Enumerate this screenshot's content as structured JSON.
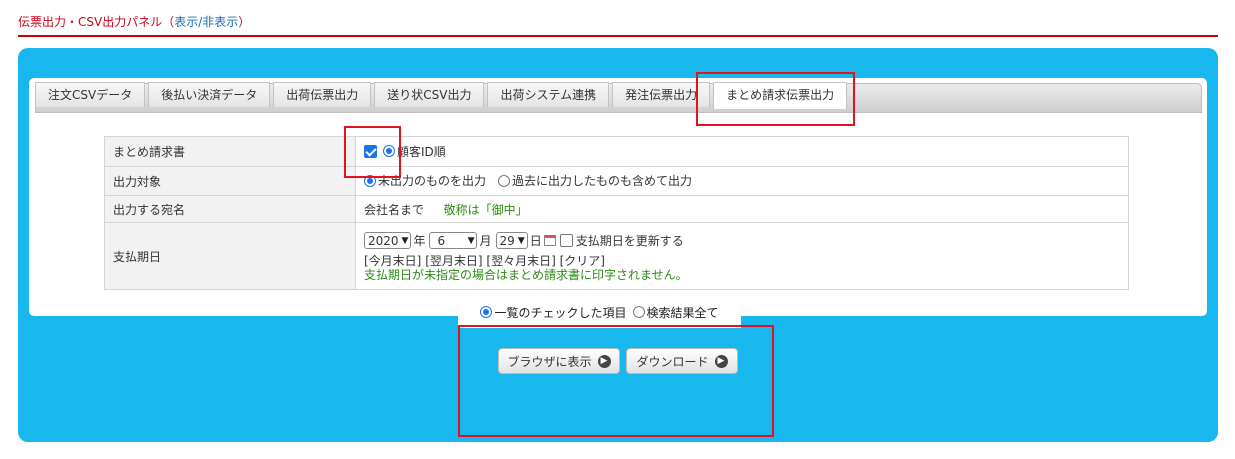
{
  "panel": {
    "title": "伝票出力・CSV出力パネル（",
    "toggle_label": "表示/非表示",
    "title_suffix": "）"
  },
  "tabs": [
    {
      "label": "注文CSVデータ",
      "active": false
    },
    {
      "label": "後払い決済データ",
      "active": false
    },
    {
      "label": "出荷伝票出力",
      "active": false
    },
    {
      "label": "送り状CSV出力",
      "active": false
    },
    {
      "label": "出荷システム連携",
      "active": false
    },
    {
      "label": "発注伝票出力",
      "active": false
    },
    {
      "label": "まとめ請求伝票出力",
      "active": true
    }
  ],
  "settings": {
    "invoice": {
      "label": "まとめ請求書",
      "checked": true,
      "sort_option": "顧客ID順"
    },
    "target": {
      "label": "出力対象",
      "options": [
        "未出力のものを出力",
        "過去に出力したものも含めて出力"
      ],
      "selected": "未出力のものを出力"
    },
    "address": {
      "label": "出力する宛名",
      "value": "会社名まで",
      "note": "敬称は「御中」"
    },
    "due_date": {
      "label": "支払期日",
      "year": "2020",
      "year_unit": "年",
      "month": "6",
      "month_unit": "月",
      "day": "29",
      "day_unit": "日",
      "update_label": "支払期日を更新する",
      "update_checked": false,
      "quick_links": [
        "[今月末日]",
        "[翌月末日]",
        "[翌々月末日]",
        "[クリア]"
      ],
      "note": "支払期日が未指定の場合はまとめ請求書に印字されません。"
    }
  },
  "scope": {
    "options": [
      "一覧のチェックした項目",
      "検索結果全て"
    ],
    "selected": "一覧のチェックした項目"
  },
  "buttons": {
    "view_label": "ブラウザに表示",
    "download_label": "ダウンロード"
  },
  "colors": {
    "panel_bg": "#18b8ee",
    "title_red": "#d0021b",
    "highlight": "#e0141e",
    "note_green": "#2e8b15"
  }
}
